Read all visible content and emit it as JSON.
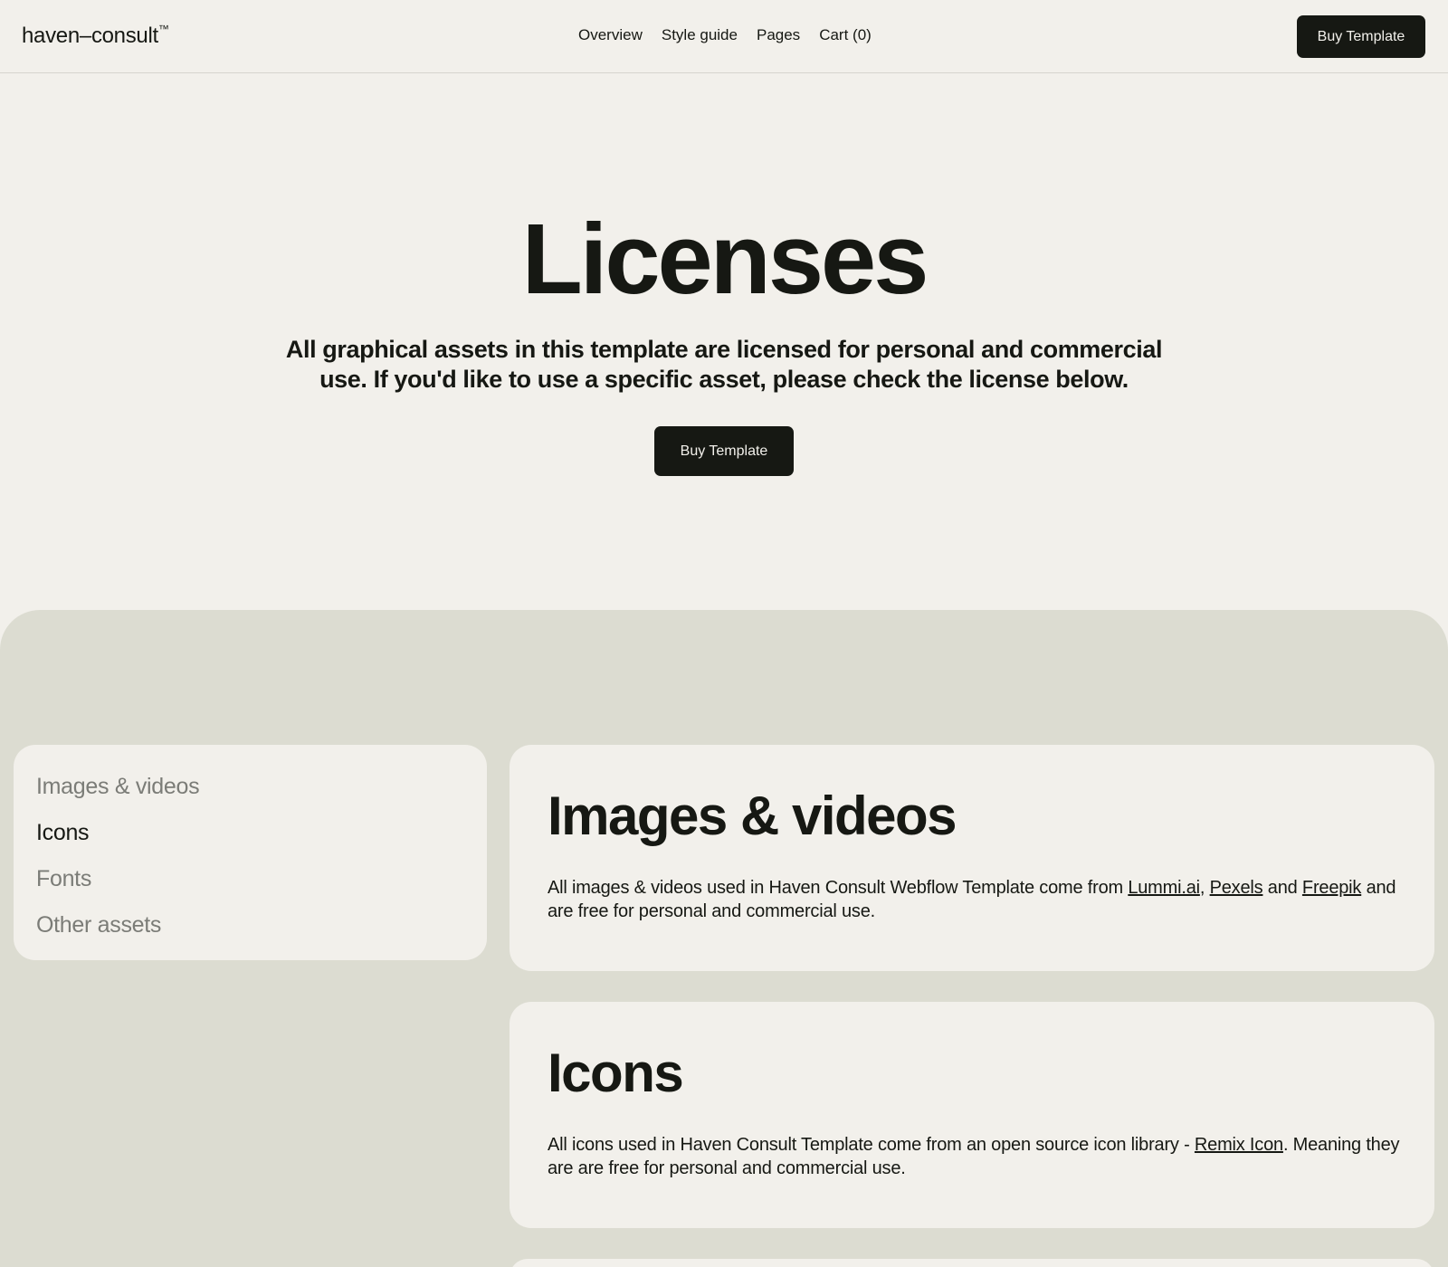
{
  "nav": {
    "logo_main": "haven–consult",
    "logo_tm": "™",
    "links": [
      "Overview",
      "Style guide",
      "Pages",
      "Cart (0)"
    ],
    "cta": "Buy Template"
  },
  "hero": {
    "title": "Licenses",
    "subtitle": "All graphical assets in this template are licensed for personal and commercial use. If you'd like to use a specific asset, please check the license below.",
    "cta": "Buy Template"
  },
  "sidebar": {
    "items": [
      {
        "label": "Images & videos",
        "active": false
      },
      {
        "label": "Icons",
        "active": true
      },
      {
        "label": "Fonts",
        "active": false
      },
      {
        "label": "Other assets",
        "active": false
      }
    ]
  },
  "sections": {
    "images": {
      "title": "Images & videos",
      "text_1": "All images & videos used in Haven Consult Webflow Template come from ",
      "link_1": "Lummi.ai",
      "sep_1": ", ",
      "link_2": "Pexels",
      "sep_2": " and ",
      "link_3": "Freepik",
      "text_2": " and are free for personal and commercial use."
    },
    "icons": {
      "title": "Icons",
      "text_1": "All icons used in Haven Consult Template come from an open source icon library - ",
      "link_1": "Remix Icon",
      "text_2": ". Meaning they are are free for personal and commercial use."
    }
  },
  "colors": {
    "background": "#f2f0eb",
    "section_bg": "#dcdcd1",
    "dark": "#161813",
    "muted_text": "#7b7c77"
  }
}
